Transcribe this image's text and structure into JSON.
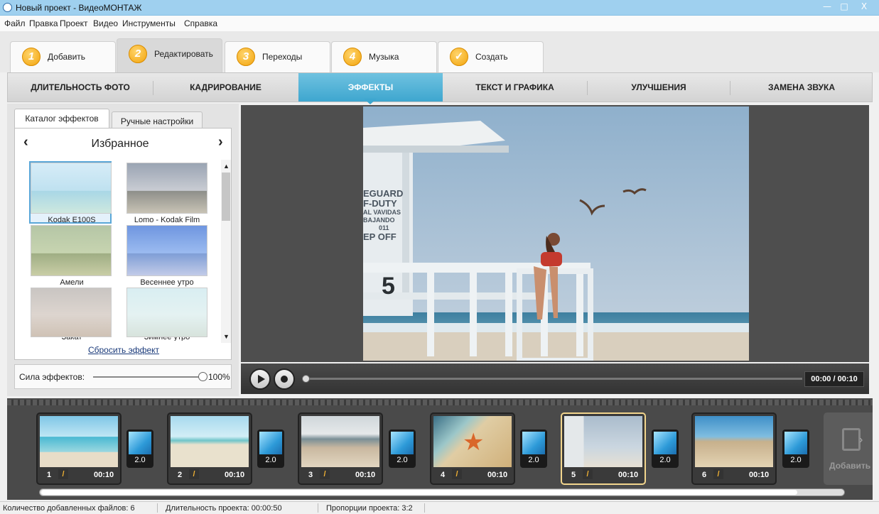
{
  "window": {
    "title": "Новый проект - ВидеоМОНТАЖ",
    "controls": [
      "—",
      "□",
      "X"
    ]
  },
  "menu": [
    "Файл",
    "Правка",
    "Проект",
    "Видео",
    "Инструменты",
    "Справка"
  ],
  "steps": [
    {
      "num": "1",
      "label": "Добавить"
    },
    {
      "num": "2",
      "label": "Редактировать"
    },
    {
      "num": "3",
      "label": "Переходы"
    },
    {
      "num": "4",
      "label": "Музыка"
    },
    {
      "num": "✓",
      "label": "Создать"
    }
  ],
  "subtabs": [
    "ДЛИТЕЛЬНОСТЬ ФОТО",
    "КАДРИРОВАНИЕ",
    "ЭФФЕКТЫ",
    "ТЕКСТ И ГРАФИКА",
    "УЛУЧШЕНИЯ",
    "ЗАМЕНА ЗВУКА"
  ],
  "panel": {
    "tabs": [
      "Каталог эффектов",
      "Ручные настройки"
    ],
    "category": "Избранное",
    "prev": "‹",
    "next": "›",
    "effects": [
      "Kodak E100S",
      "Lomo - Kodak Film",
      "Амели",
      "Весеннее утро",
      "Закат",
      "Зимнее утро"
    ],
    "reset": "Сбросить эффект",
    "strength_label": "Сила эффектов:",
    "strength_value": "100%"
  },
  "preview": {
    "sign_lines": [
      "EGUARD",
      "F-DUTY",
      "AL VAVIDAS",
      "BAJANDO",
      "011",
      "EP OFF"
    ],
    "tower_number": "5"
  },
  "player": {
    "time": "00:00 / 00:10"
  },
  "timeline": {
    "clips": [
      {
        "num": "1",
        "duration": "00:10"
      },
      {
        "num": "2",
        "duration": "00:10"
      },
      {
        "num": "3",
        "duration": "00:10"
      },
      {
        "num": "4",
        "duration": "00:10"
      },
      {
        "num": "5",
        "duration": "00:10"
      },
      {
        "num": "6",
        "duration": "00:10"
      }
    ],
    "transitions": [
      "2.0",
      "2.0",
      "2.0",
      "2.0",
      "2.0",
      "2.0"
    ],
    "add_label": "Добавить"
  },
  "status": {
    "files": "Количество добавленных файлов: 6",
    "duration": "Длительность проекта:  00:00:50",
    "ratio": "Пропорции проекта:  3:2"
  }
}
